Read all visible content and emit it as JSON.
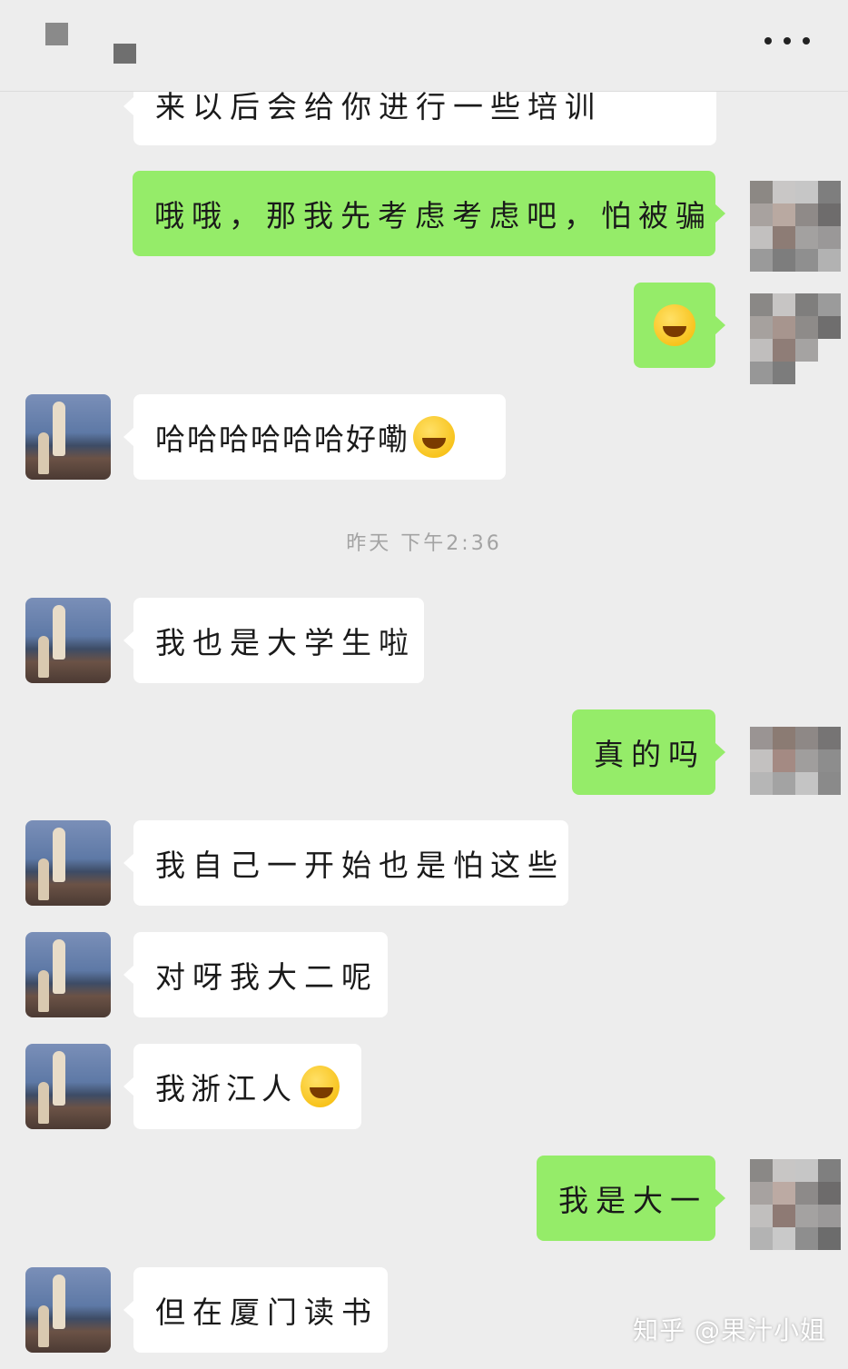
{
  "header": {
    "more_icon": "more-icon"
  },
  "messages": {
    "m1": "来以后会给你进行一些培训",
    "m2": "哦哦，那我先考虑考虑吧，怕被骗",
    "m3_icon": "laugh-tears-emoji",
    "m4": "哈哈哈哈哈哈好嘞",
    "m4_icon": "facepalm-emoji",
    "timestamp": "昨天 下午2:36",
    "m5": "我也是大学生啦",
    "m6": "真的吗",
    "m7": "我自己一开始也是怕这些",
    "m8": "对呀我大二呢",
    "m9": "我浙江人",
    "m9_icon": "grin-emoji",
    "m10": "我是大一",
    "m11": "但在厦门读书"
  },
  "watermark": "知乎 @果汁小姐",
  "colors": {
    "background": "#ededed",
    "self_bubble": "#95ec69",
    "other_bubble": "#ffffff"
  }
}
